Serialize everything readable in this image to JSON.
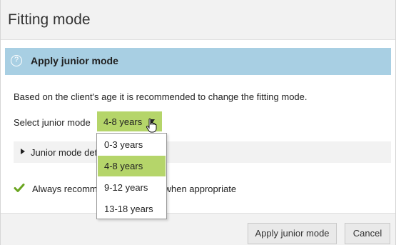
{
  "dialog": {
    "title": "Fitting mode"
  },
  "info_bar": {
    "icon": "help-icon",
    "icon_glyph": "?",
    "text": "Apply junior mode",
    "color": "#a8cfe3"
  },
  "recommendation_text": "Based on the client's age it is recommended to change the fitting mode.",
  "select": {
    "label": "Select junior mode",
    "value": "4-8 years",
    "accent": "#b5d56a",
    "options": [
      "0-3 years",
      "4-8 years",
      "9-12 years",
      "13-18 years"
    ],
    "selected_index": 1
  },
  "details": {
    "label": "Junior mode det"
  },
  "checkbox": {
    "checked": true,
    "label": "Always recomm",
    "label_tail": "e when appropriate"
  },
  "footer": {
    "apply_label": "Apply junior mode",
    "cancel_label": "Cancel"
  }
}
